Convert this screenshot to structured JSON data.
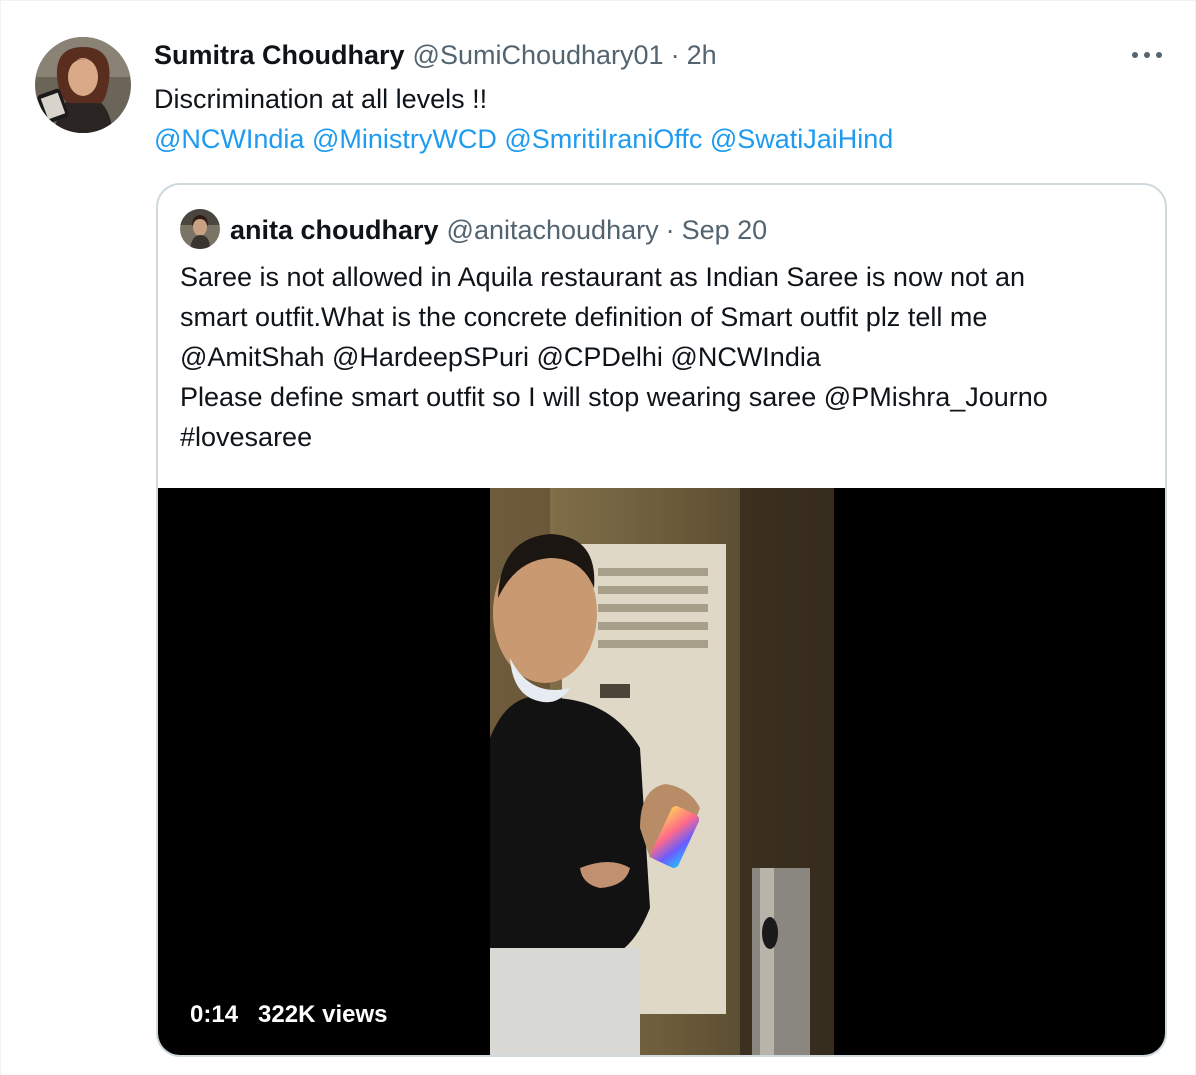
{
  "tweet": {
    "display_name": "Sumitra Choudhary",
    "handle": "@SumiChoudhary01",
    "separator": "·",
    "time": "2h",
    "text": "Discrimination at all levels !!",
    "mentions": [
      "@NCWIndia",
      "@MinistryWCD",
      "@SmritiIraniOffc",
      "@SwatiJaiHind"
    ],
    "more_icon": "more-horizontal-icon",
    "link_color": "#1d9bf0"
  },
  "quoted_tweet": {
    "display_name": "anita choudhary",
    "handle": "@anitachoudhary",
    "separator": "·",
    "date": "Sep 20",
    "text_lines": [
      "Saree is not allowed in Aquila restaurant as Indian Saree is now not an",
      "smart outfit.What is the concrete definition of Smart outfit plz tell me",
      "@AmitShah @HardeepSPuri @CPDelhi @NCWIndia",
      "Please define smart outfit so I will stop wearing saree @PMishra_Journo",
      "#lovesaree"
    ],
    "video": {
      "duration": "0:14",
      "views": "322K views"
    }
  }
}
